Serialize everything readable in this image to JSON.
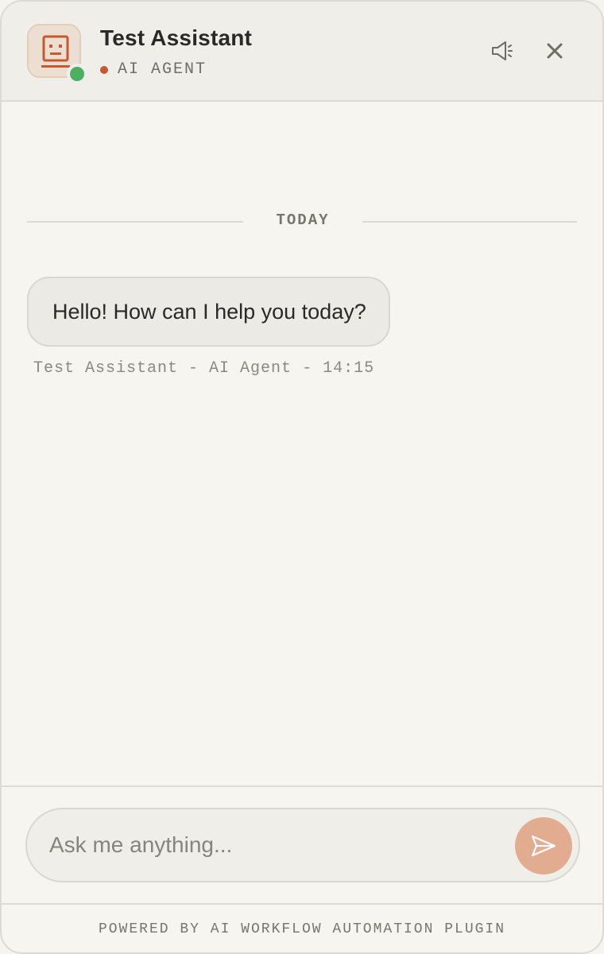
{
  "header": {
    "title": "Test Assistant",
    "subtitle": "AI AGENT",
    "avatar_icon": "robot-face-icon",
    "status": "online",
    "sound_icon": "speaker-icon",
    "close_icon": "close-icon"
  },
  "messages": {
    "date_divider": "TODAY",
    "items": [
      {
        "text": "Hello! How can I help you today?",
        "sender": "Test Assistant",
        "role": "AI Agent",
        "time": "14:15"
      }
    ]
  },
  "composer": {
    "placeholder": "Ask me anything...",
    "value": "",
    "send_icon": "send-icon"
  },
  "footer": {
    "text": "POWERED BY AI WORKFLOW AUTOMATION PLUGIN"
  },
  "colors": {
    "accent": "#c7592e",
    "online": "#4caf62",
    "send_button": "#e2ac90",
    "background": "#f6f5ef"
  }
}
